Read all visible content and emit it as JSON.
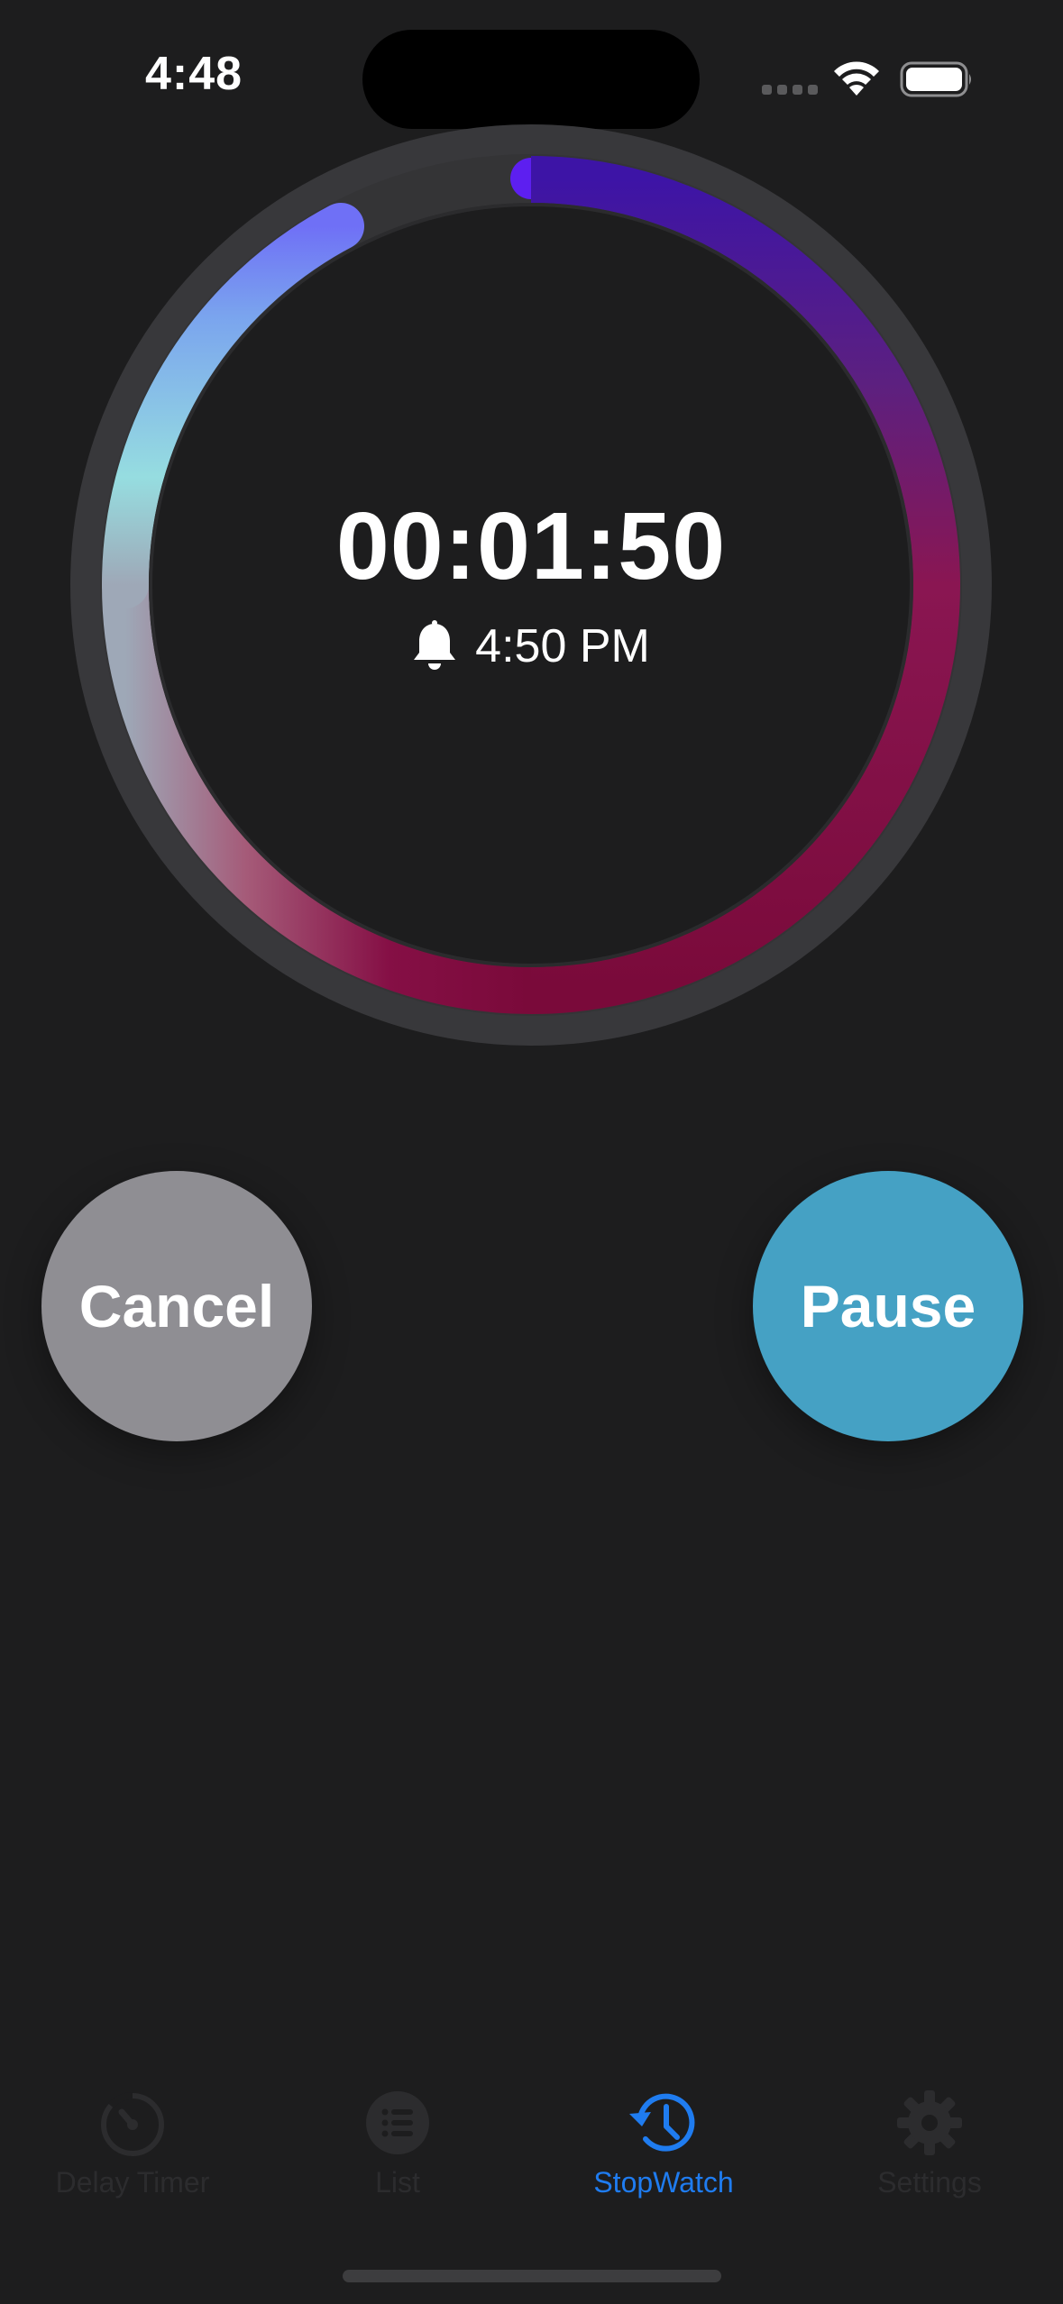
{
  "status_bar": {
    "time": "4:48"
  },
  "timer": {
    "remaining": "00:01:50",
    "alarm_time": "4:50 PM",
    "progress_fraction": 0.92
  },
  "buttons": {
    "cancel_label": "Cancel",
    "pause_label": "Pause"
  },
  "tabs": [
    {
      "label": "Delay Timer",
      "icon": "stopwatch-icon",
      "active": false
    },
    {
      "label": "List",
      "icon": "list-icon",
      "active": false
    },
    {
      "label": "StopWatch",
      "icon": "history-clock-icon",
      "active": true
    },
    {
      "label": "Settings",
      "icon": "gear-icon",
      "active": false
    }
  ],
  "colors": {
    "background": "#1d1d1e",
    "cancel_button": "#8f8e93",
    "pause_button": "#45a1c4",
    "active_tab": "#1f7cf0",
    "inactive_tab": "#2c2c2e",
    "ring_track": "#343436"
  }
}
